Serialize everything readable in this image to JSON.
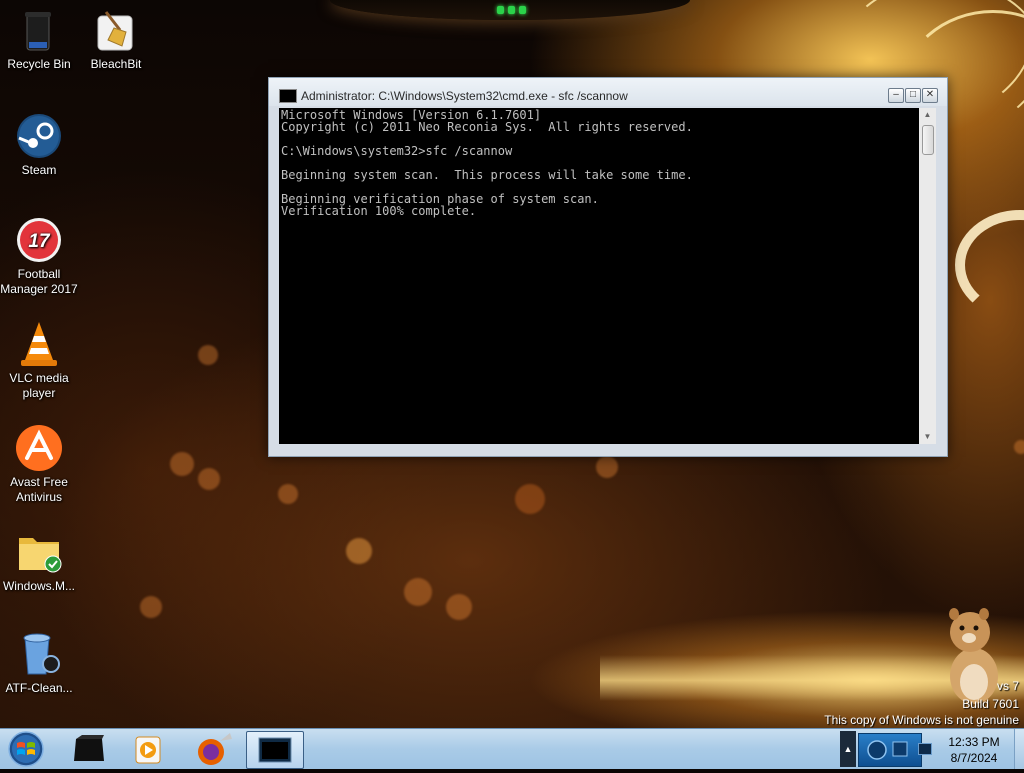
{
  "desktop": {
    "icons": [
      {
        "label": "Recycle Bin",
        "icon": "recycle-bin-icon"
      },
      {
        "label": "BleachBit",
        "icon": "bleachbit-icon"
      },
      {
        "label": "Steam",
        "icon": "steam-icon"
      },
      {
        "label": "Football Manager 2017",
        "icon": "football-manager-icon",
        "badge": "17"
      },
      {
        "label": "VLC media player",
        "icon": "vlc-icon"
      },
      {
        "label": "Avast Free Antivirus",
        "icon": "avast-icon"
      },
      {
        "label": "Windows.M...",
        "icon": "folder-icon"
      },
      {
        "label": "ATF-Clean...",
        "icon": "atf-cleaner-icon"
      }
    ]
  },
  "cmd_window": {
    "title": "Administrator: C:\\Windows\\System32\\cmd.exe - sfc  /scannow",
    "console_text": "Microsoft Windows [Version 6.1.7601]\nCopyright (c) 2011 Neo Reconia Sys.  All rights reserved.\n\nC:\\Windows\\system32>sfc /scannow\n\nBeginning system scan.  This process will take some time.\n\nBeginning verification phase of system scan.\nVerification 100% complete.",
    "minimize_glyph": "–",
    "maximize_glyph": "□",
    "close_glyph": "✕",
    "scroll_up_glyph": "▲",
    "scroll_down_glyph": "▼",
    "colors": {
      "console_bg": "#000000",
      "console_text": "#c0c0c0",
      "frame": "#d6dde6"
    }
  },
  "watermark": {
    "line1": "vs 7",
    "line2": "Build 7601",
    "line3": "This copy of Windows is not genuine"
  },
  "taskbar": {
    "start_icon": "windows-start-orb-icon",
    "pinned": [
      "terminal-box-icon",
      "media-player-icon",
      "firefox-icon",
      "cmd-window-icon"
    ],
    "tray_arrow_glyph": "▲",
    "clock_time": "12:33 PM",
    "clock_date": "8/7/2024"
  }
}
